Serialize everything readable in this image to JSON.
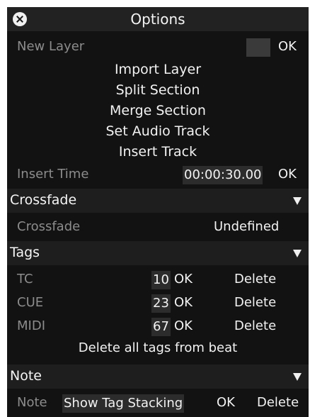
{
  "title": "Options",
  "new_layer": {
    "label": "New Layer",
    "ok": "OK"
  },
  "actions": [
    "Import Layer",
    "Split Section",
    "Merge Section",
    "Set Audio Track",
    "Insert Track"
  ],
  "insert_time": {
    "label": "Insert Time",
    "value": "00:00:30.00",
    "ok": "OK"
  },
  "crossfade": {
    "header": "Crossfade",
    "label": "Crossfade",
    "value": "Undefined"
  },
  "tags": {
    "header": "Tags",
    "rows": [
      {
        "name": "TC",
        "value": "10",
        "ok": "OK",
        "delete": "Delete"
      },
      {
        "name": "CUE",
        "value": "23",
        "ok": "OK",
        "delete": "Delete"
      },
      {
        "name": "MIDI",
        "value": "67",
        "ok": "OK",
        "delete": "Delete"
      }
    ],
    "delete_all": "Delete all tags from beat"
  },
  "note": {
    "header": "Note",
    "label": "Note",
    "value": "Show Tag Stacking",
    "ok": "OK",
    "delete": "Delete"
  },
  "colors": {
    "panel": "#121212",
    "header": "#222222",
    "dim_text": "#8c8c8c"
  },
  "icons": {
    "close": "close-icon",
    "collapse": "triangle-down-icon"
  }
}
